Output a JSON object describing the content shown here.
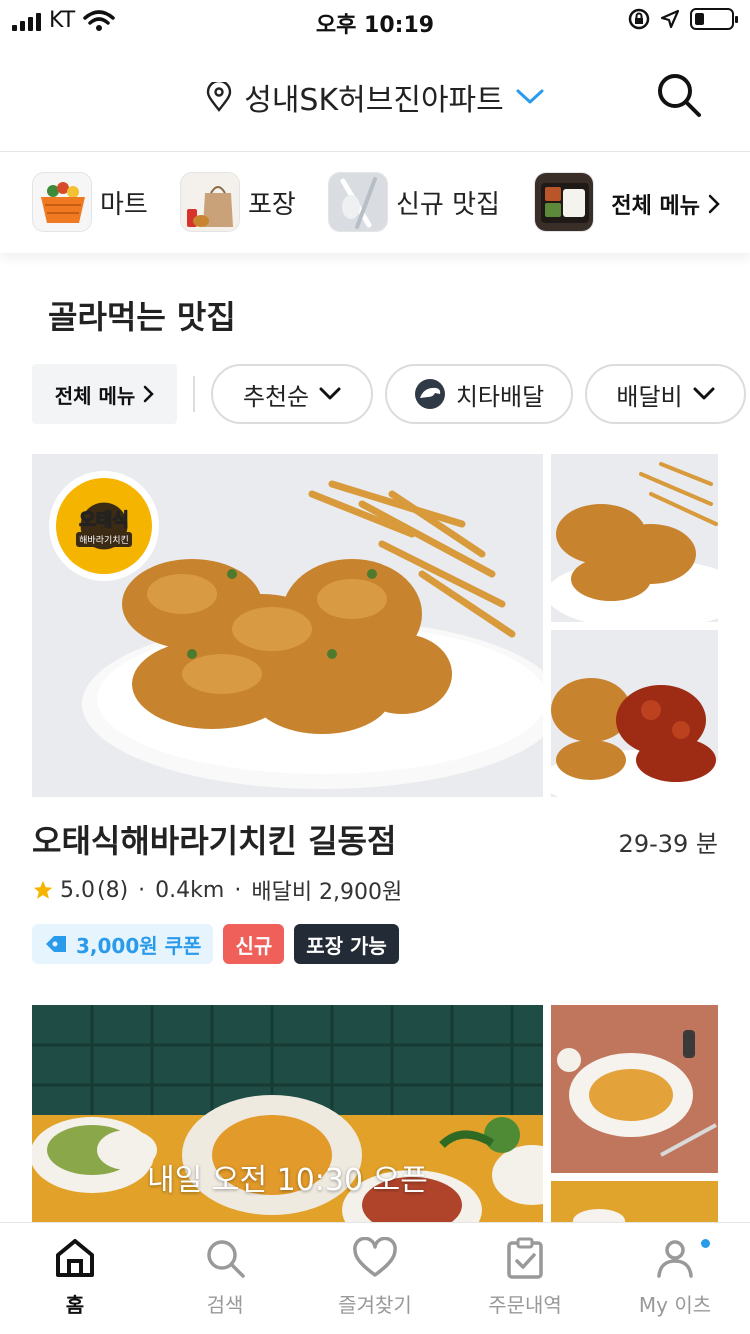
{
  "status_bar": {
    "carrier": "KT",
    "time": "오후 10:19",
    "battery_level": 0.25
  },
  "header": {
    "address": "성내SK허브진아파트",
    "accent": "#2a9bea"
  },
  "categories": [
    {
      "label": "마트",
      "icon": "basket-icon"
    },
    {
      "label": "포장",
      "icon": "takeout-bag-icon"
    },
    {
      "label": "신규 맛집",
      "icon": "cutlery-icon"
    },
    {
      "label": "",
      "icon": "lunchbox-icon"
    }
  ],
  "all_menu_top": "전체 메뉴",
  "section_title": "골라먹는 맛집",
  "filters": {
    "all_menu": "전체 메뉴",
    "sort": "추천순",
    "cheetah": "치타배달",
    "fee": "배달비"
  },
  "restaurants": [
    {
      "logo_text": "오태식",
      "logo_sub": "해바라기치킨",
      "name": "오태식해바라기치킨 길동점",
      "eta": "29-39 분",
      "rating": "5.0",
      "reviews": "(8)",
      "distance": "0.4km",
      "delivery_fee": "배달비 2,900원",
      "coupon": "3,000원 쿠폰",
      "tag_new": "신규",
      "tag_pack": "포장 가능"
    },
    {
      "overlay": "내일 오전 10:30 오픈"
    }
  ],
  "tabs": [
    {
      "label": "홈",
      "icon": "home-icon",
      "active": true
    },
    {
      "label": "검색",
      "icon": "search-icon",
      "active": false
    },
    {
      "label": "즐겨찾기",
      "icon": "heart-icon",
      "active": false
    },
    {
      "label": "주문내역",
      "icon": "clipboard-icon",
      "active": false
    },
    {
      "label": "My 이츠",
      "icon": "person-icon",
      "active": false
    }
  ]
}
